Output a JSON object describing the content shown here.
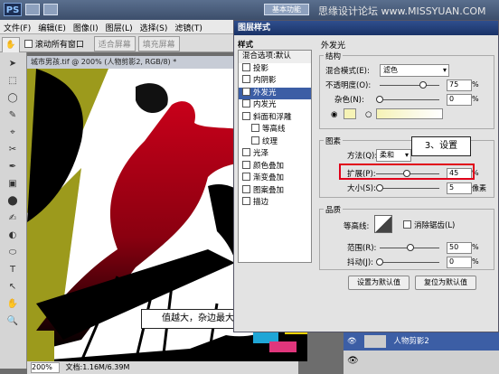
{
  "titlebar": {
    "logo": "PS",
    "watermark": "思缘设计论坛 www.MISSYUAN.COM",
    "workspace_button": "基本功能"
  },
  "menubar": {
    "items": [
      "文件(F)",
      "编辑(E)",
      "图像(I)",
      "图层(L)",
      "选择(S)",
      "滤镜(T)"
    ]
  },
  "options_bar": {
    "scroll_all_label": "滚动所有窗口",
    "fit_screen_label": "适合屏幕",
    "fill_screen_label": "填充屏幕"
  },
  "document": {
    "tab_title": "城市男孩.tif @ 200% (人物剪影2, RGB/8) *",
    "zoom": "200%",
    "doc_size": "文档:1.16M/6.39M"
  },
  "dialog": {
    "title": "图层样式",
    "styles_header": "样式",
    "blend_options": "混合选项:默认",
    "styles": [
      {
        "label": "投影",
        "checked": false,
        "selected": false,
        "indent": false
      },
      {
        "label": "内阴影",
        "checked": false,
        "selected": false,
        "indent": false
      },
      {
        "label": "外发光",
        "checked": true,
        "selected": true,
        "indent": false
      },
      {
        "label": "内发光",
        "checked": false,
        "selected": false,
        "indent": false
      },
      {
        "label": "斜面和浮雕",
        "checked": false,
        "selected": false,
        "indent": false
      },
      {
        "label": "等高线",
        "checked": false,
        "selected": false,
        "indent": true
      },
      {
        "label": "纹理",
        "checked": false,
        "selected": false,
        "indent": true
      },
      {
        "label": "光泽",
        "checked": false,
        "selected": false,
        "indent": false
      },
      {
        "label": "颜色叠加",
        "checked": false,
        "selected": false,
        "indent": false
      },
      {
        "label": "渐变叠加",
        "checked": false,
        "selected": false,
        "indent": false
      },
      {
        "label": "图案叠加",
        "checked": false,
        "selected": false,
        "indent": false
      },
      {
        "label": "描边",
        "checked": false,
        "selected": false,
        "indent": false
      }
    ],
    "section_title": "外发光",
    "structure": {
      "title": "结构",
      "blend_mode_label": "混合模式(E):",
      "blend_mode_value": "滤色",
      "opacity_label": "不透明度(O):",
      "opacity_value": "75",
      "opacity_unit": "%",
      "noise_label": "杂色(N):",
      "noise_value": "0",
      "noise_unit": "%",
      "glow_color": "#f6f3b6"
    },
    "elements": {
      "title": "图素",
      "technique_label": "方法(Q):",
      "technique_value": "柔和",
      "spread_label": "扩展(P):",
      "spread_value": "45",
      "spread_unit": "%",
      "size_label": "大小(S):",
      "size_value": "5",
      "size_unit": "像素"
    },
    "quality": {
      "title": "品质",
      "contour_label": "等高线:",
      "antialias_label": "消除锯齿(L)",
      "range_label": "范围(R):",
      "range_value": "50",
      "range_unit": "%",
      "jitter_label": "抖动(J):",
      "jitter_value": "0",
      "jitter_unit": "%"
    },
    "make_default": "设置为默认值",
    "reset_default": "复位为默认值"
  },
  "callouts": {
    "step": "3、设置",
    "tip": "值越大，杂边最大，反之则小"
  },
  "layers": {
    "active_layer": "人物剪影2"
  },
  "colors": {
    "accent": "#3c5ea5",
    "highlight": "#e0001a",
    "olive": "#9c9a1c"
  }
}
